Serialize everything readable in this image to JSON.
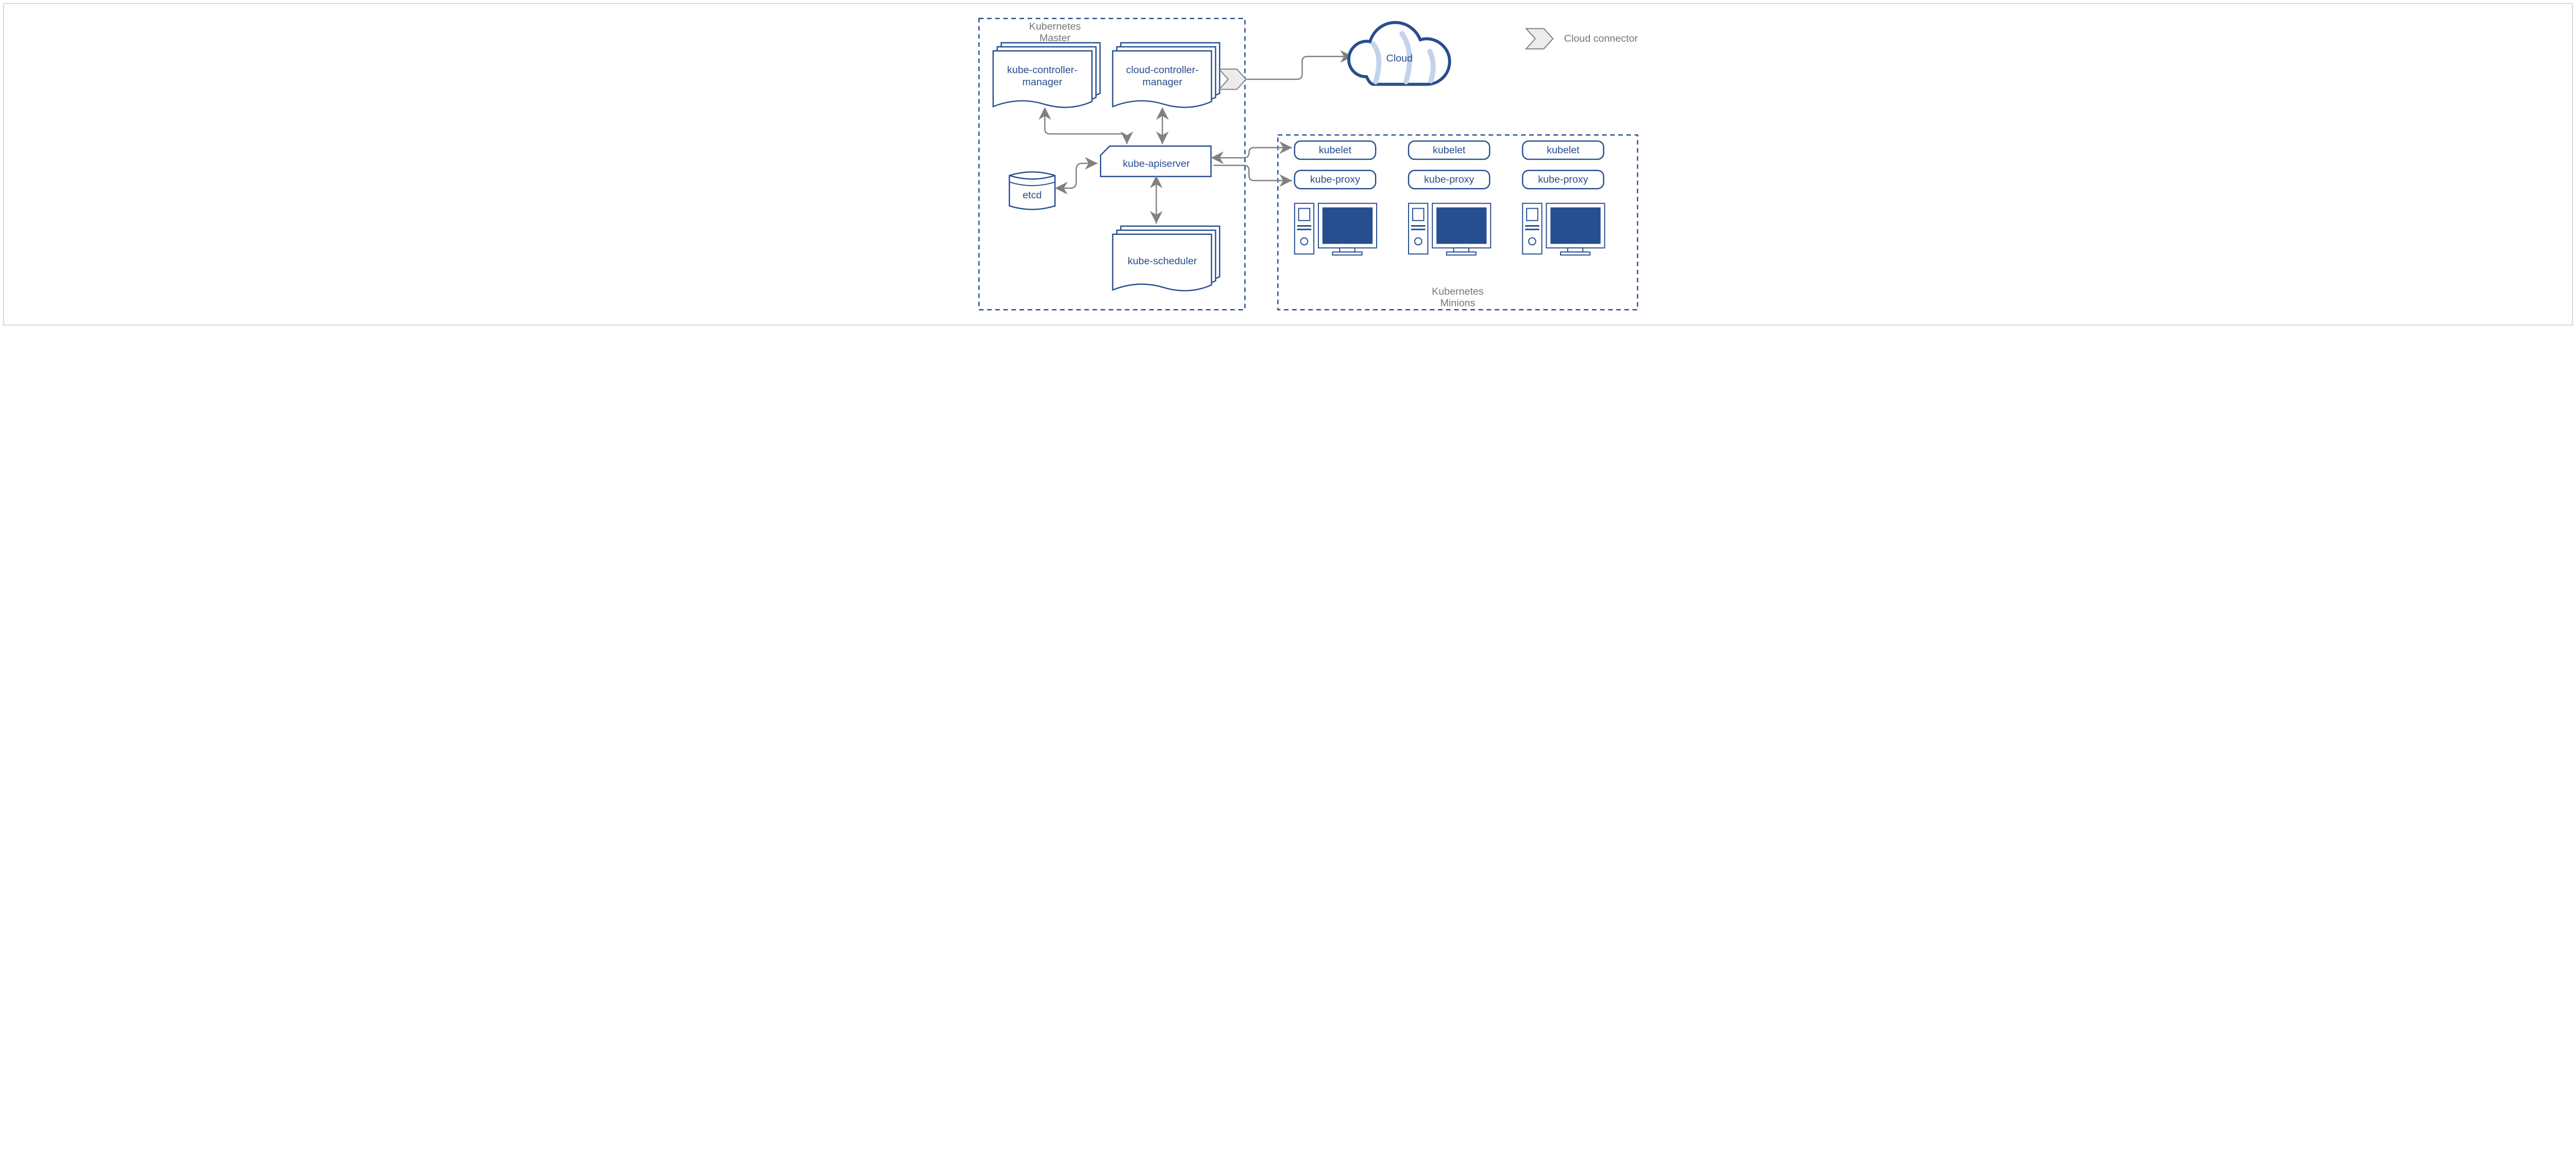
{
  "diagram": {
    "master_title_l1": "Kubernetes",
    "master_title_l2": "Master",
    "kube_controller_l1": "kube-controller-",
    "kube_controller_l2": "manager",
    "cloud_controller_l1": "cloud-controller-",
    "cloud_controller_l2": "manager",
    "apiserver": "kube-apiserver",
    "etcd": "etcd",
    "scheduler": "kube-scheduler",
    "cloud": "Cloud",
    "kubelet": "kubelet",
    "kube_proxy": "kube-proxy",
    "minions_title_l1": "Kubernetes",
    "minions_title_l2": "Minions",
    "legend": "Cloud connector"
  }
}
